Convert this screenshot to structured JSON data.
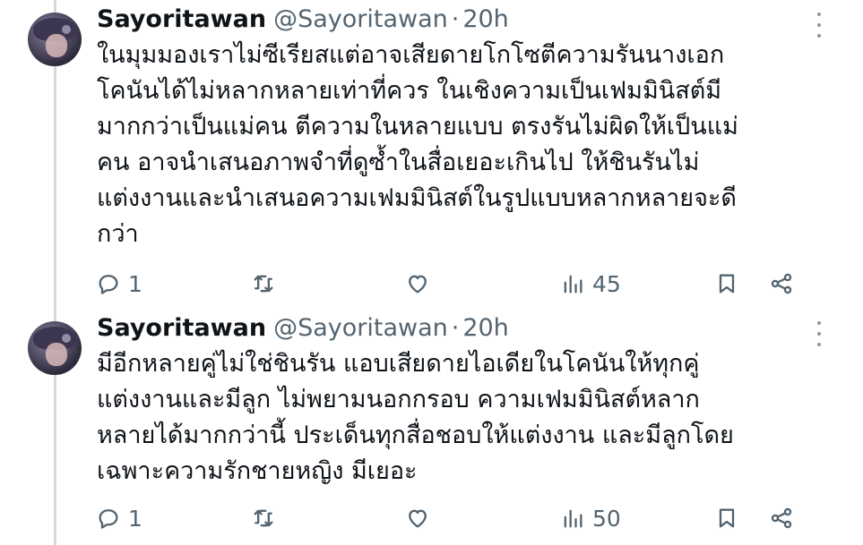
{
  "tweets": [
    {
      "display_name": "Sayoritawan",
      "handle": "@Sayoritawan",
      "separator": "·",
      "time": "20h",
      "text_lines": [
        "ในมุมมองเราไม่ซีเรียสแต่อาจเสียดายโกโซตีความรันนางเอก",
        "โคนันได้ไม่หลากหลายเท่าที่ควร ในเชิงความเป็นเฟมมินิสต์มี",
        "มากกว่าเป็นแม่คน ตีความในหลายแบบ ตรงรันไม่ผิดให้เป็นแม่",
        "คน อาจนำเสนอภาพจำที่ดูซ้ำในสื่อเยอะเกินไป ให้ชินรันไม่",
        "แต่งงานและนำเสนอความเฟมมินิสต์ในรูปแบบหลากหลายจะดี",
        "กว่า"
      ],
      "replies": "1",
      "retweets": "",
      "likes": "",
      "views": "45"
    },
    {
      "display_name": "Sayoritawan",
      "handle": "@Sayoritawan",
      "separator": "·",
      "time": "20h",
      "text_lines": [
        "มีอีกหลายคู่ไม่ใช่ชินรัน แอบเสียดายไอเดียในโคนันให้ทุกคู่",
        "แต่งงานและมีลูก ไม่พยามนอกกรอบ ความเฟมมินิสต์หลาก",
        "หลายได้มากกว่านี้ ประเด็นทุกสื่อชอบให้แต่งงาน และมีลูกโดย",
        "เฉพาะความรักชายหญิง มีเยอะ"
      ],
      "replies": "1",
      "retweets": "",
      "likes": "",
      "views": "50"
    }
  ],
  "icons": {
    "reply": "reply-icon",
    "retweet": "retweet-icon",
    "like": "heart-icon",
    "views": "views-icon",
    "bookmark": "bookmark-icon",
    "share": "share-icon",
    "more": "more-icon"
  },
  "colors": {
    "text": "#0f1419",
    "secondary": "#536471",
    "thread_line": "#cfd9de"
  }
}
